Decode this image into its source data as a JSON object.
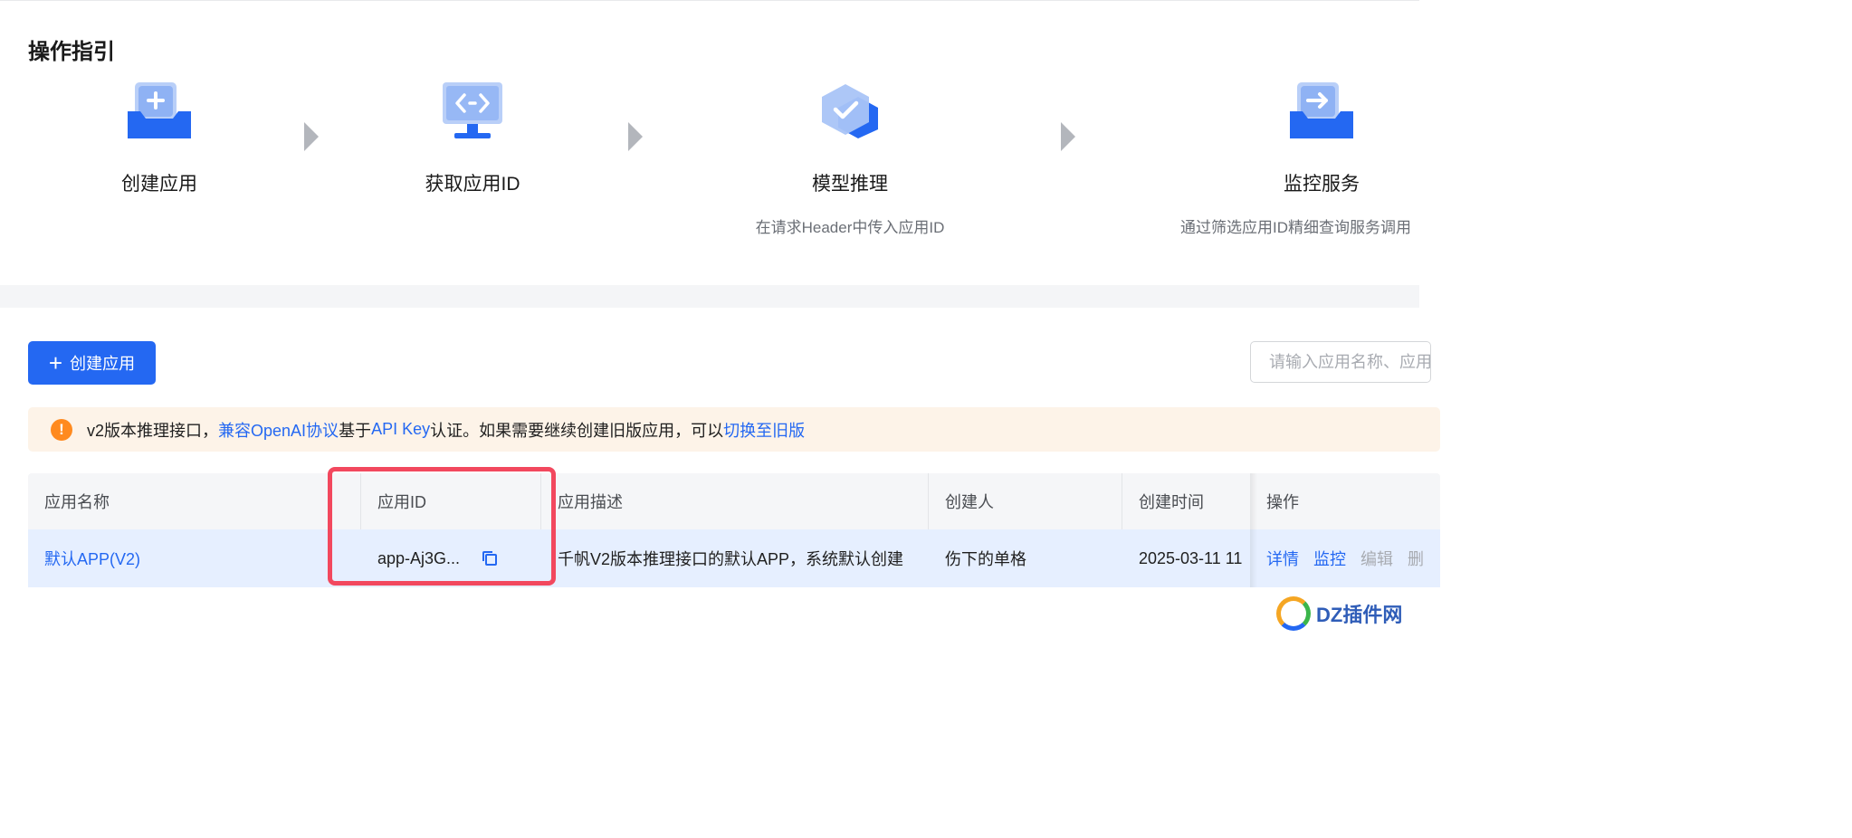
{
  "guide": {
    "title": "操作指引",
    "steps": [
      {
        "icon": "create-app-icon",
        "label": "创建应用",
        "desc": ""
      },
      {
        "icon": "get-app-id-icon",
        "label": "获取应用ID",
        "desc": ""
      },
      {
        "icon": "model-inference-icon",
        "label": "模型推理",
        "desc": "在请求Header中传入应用ID"
      },
      {
        "icon": "monitor-service-icon",
        "label": "监控服务",
        "desc": "通过筛选应用ID精细查询服务调用"
      }
    ]
  },
  "toolbar": {
    "create_label": "创建应用",
    "search_placeholder": "请输入应用名称、应用"
  },
  "notice": {
    "text_prefix": "v2版本推理接口，",
    "link_openai": "兼容OpenAI协议",
    "text_mid1": "基于",
    "link_apikey": "API Key",
    "text_mid2": "认证。如果需要继续创建旧版应用，可以",
    "link_switch": "切换至旧版"
  },
  "table": {
    "headers": {
      "name": "应用名称",
      "app_id": "应用ID",
      "desc": "应用描述",
      "creator": "创建人",
      "created_at": "创建时间",
      "actions": "操作"
    },
    "rows": [
      {
        "name": "默认APP(V2)",
        "app_id": "app-Aj3G...",
        "desc": "千帆V2版本推理接口的默认APP，系统默认创建",
        "creator": "伤下的单格",
        "created_at": "2025-03-11 11",
        "actions": {
          "detail": "详情",
          "monitor": "监控",
          "edit": "编辑",
          "delete": "删"
        }
      }
    ]
  },
  "colors": {
    "primary": "#2468f2",
    "highlight": "#f2485e",
    "warning": "#ff8a1f"
  },
  "watermark": {
    "text": "DZ插件网"
  }
}
